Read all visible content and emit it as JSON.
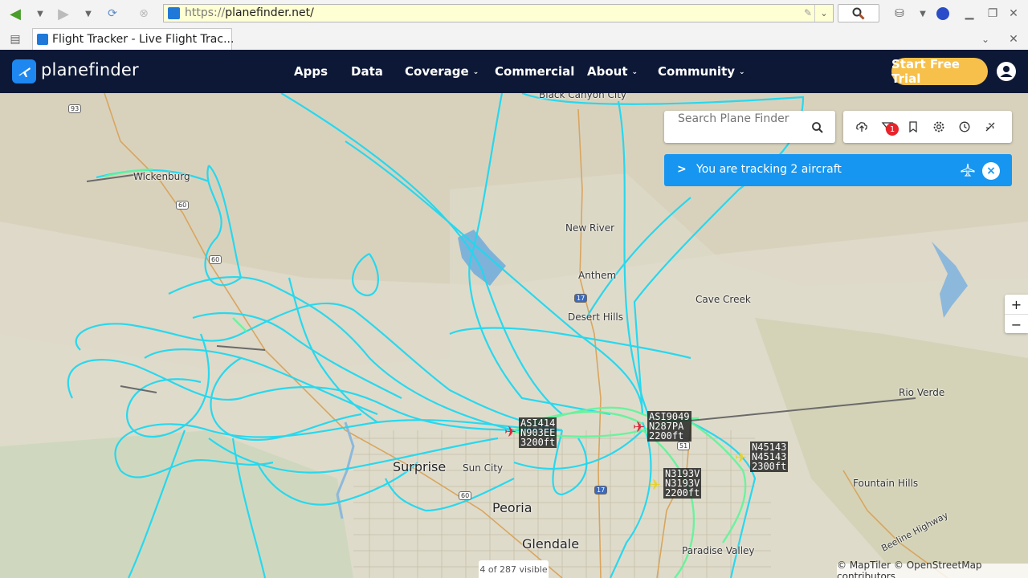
{
  "browser": {
    "url_proto": "https://",
    "url_host": "planefinder.net/",
    "tab_title": "Flight Tracker - Live Flight Trac..."
  },
  "nav": {
    "logo": "planefinder",
    "items": [
      {
        "label": "Apps",
        "has_caret": false
      },
      {
        "label": "Data",
        "has_caret": false
      },
      {
        "label": "Coverage",
        "has_caret": true
      },
      {
        "label": "Commercial",
        "has_caret": false
      },
      {
        "label": "About",
        "has_caret": true
      },
      {
        "label": "Community",
        "has_caret": true
      }
    ],
    "cta": "Start Free Trial",
    "caret": "⌄"
  },
  "map": {
    "search_placeholder": "Search Plane Finder",
    "alert_count": "1",
    "tracking_text": "You are tracking 2 aircraft",
    "tracking_chevron": ">",
    "tracking_close": "×",
    "zoom_in": "+",
    "zoom_out": "−",
    "visible_count": "4 of 287 visible",
    "attribution": "© MapTiler © OpenStreetMap contributors",
    "colors": {
      "track_cyan": "#1fd8f0",
      "track_green": "#5ef59a",
      "nav_bg": "#0d1836",
      "cta": "#f6c04a",
      "banner": "#1696f0"
    },
    "places": {
      "black_canyon": "Black Canyon City",
      "wickenburg": "Wickenburg",
      "new_river": "New River",
      "anthem": "Anthem",
      "cave_creek": "Cave Creek",
      "desert_hills": "Desert Hills",
      "rio_verde": "Rio Verde",
      "surprise": "Surprise",
      "sun_city": "Sun City",
      "peoria": "Peoria",
      "glendale": "Glendale",
      "fountain_hills": "Fountain Hills",
      "paradise_valley": "Paradise Valley",
      "beeline": "Beeline Highway"
    },
    "shields": {
      "r93": "93",
      "r60a": "60",
      "r60b": "60",
      "i17a": "17",
      "i51": "51",
      "i17b": "17",
      "r60c": "60"
    },
    "aircraft": [
      {
        "callsign": "ASI414",
        "reg": "N903EE",
        "alt": "3200ft",
        "color": "red"
      },
      {
        "callsign": "ASI9049",
        "reg": "N287PA",
        "alt": "2200ft",
        "color": "red"
      },
      {
        "callsign": "N45143",
        "reg": "N45143",
        "alt": "2300ft",
        "color": "yellow"
      },
      {
        "callsign": "N3193V",
        "reg": "N3193V",
        "alt": "2200ft",
        "color": "yellow"
      }
    ]
  }
}
